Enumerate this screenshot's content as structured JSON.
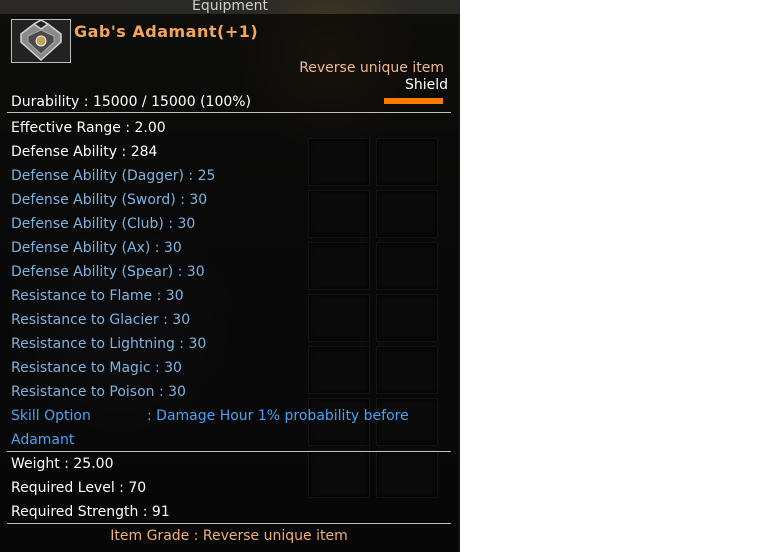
{
  "window": {
    "title": "Equipment"
  },
  "item": {
    "name": "Gab's Adamant(+1)",
    "rarity": "Reverse unique item",
    "type": "Shield",
    "durability_text": "Durability : 15000 / 15000 (100%)",
    "durability_fraction": 1.0,
    "durability_color": "#ff7a00"
  },
  "stats": [
    {
      "text": "Effective Range : 2.00",
      "color": "white"
    },
    {
      "text": "Defense Ability : 284",
      "color": "white"
    },
    {
      "text": "Defense Ability (Dagger) : 25",
      "color": "blue"
    },
    {
      "text": "Defense Ability (Sword) : 30",
      "color": "blue"
    },
    {
      "text": "Defense Ability (Club) : 30",
      "color": "blue"
    },
    {
      "text": "Defense Ability (Ax) : 30",
      "color": "blue"
    },
    {
      "text": "Defense Ability (Spear) : 30",
      "color": "blue"
    },
    {
      "text": "Resistance to Flame : 30",
      "color": "blue"
    },
    {
      "text": "Resistance to Glacier : 30",
      "color": "blue"
    },
    {
      "text": "Resistance to Lightning : 30",
      "color": "blue"
    },
    {
      "text": "Resistance to Magic : 30",
      "color": "blue"
    },
    {
      "text": "Resistance to Poison : 30",
      "color": "blue"
    }
  ],
  "skill": {
    "label": "Skill Option",
    "description": ": Damage Hour 1% probability before",
    "continuation": "Adamant"
  },
  "requirements": {
    "weight": "Weight : 25.00",
    "level": "Required Level : 70",
    "strength": "Required Strength : 91"
  },
  "grade": "Item Grade : Reverse unique item",
  "colors": {
    "name": "#f0a75a",
    "stat_white": "#ffffff",
    "stat_blue": "#7fb3de",
    "skill": "#4aa3f5",
    "grade": "#f0b074"
  }
}
